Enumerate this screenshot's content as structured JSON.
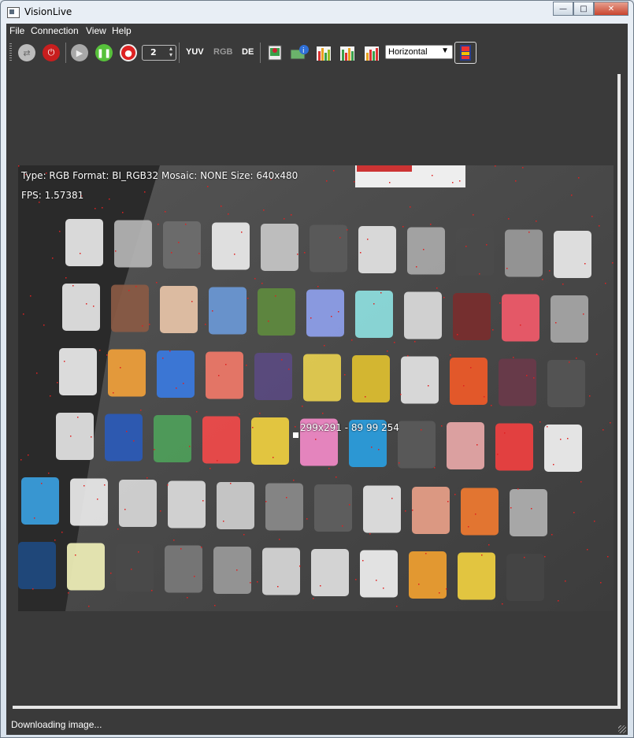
{
  "window": {
    "title": "VisionLive"
  },
  "menubar": [
    "File",
    "Connection",
    "View",
    "Help"
  ],
  "toolbar": {
    "frame_count": "2",
    "modes": [
      "YUV",
      "RGB",
      "DE"
    ],
    "layout_select": "Horizontal"
  },
  "overlay": {
    "info_line": "Type: RGB Format: BI_RGB32 Mosaic: NONE Size: 640x480",
    "fps_line": "FPS: 1.57381",
    "cursor_readout": "299x291 - 89 99 254"
  },
  "status": {
    "text": "Downloading image..."
  },
  "colors": {
    "background": "#3a3a3a",
    "accent_red": "#d32020"
  }
}
